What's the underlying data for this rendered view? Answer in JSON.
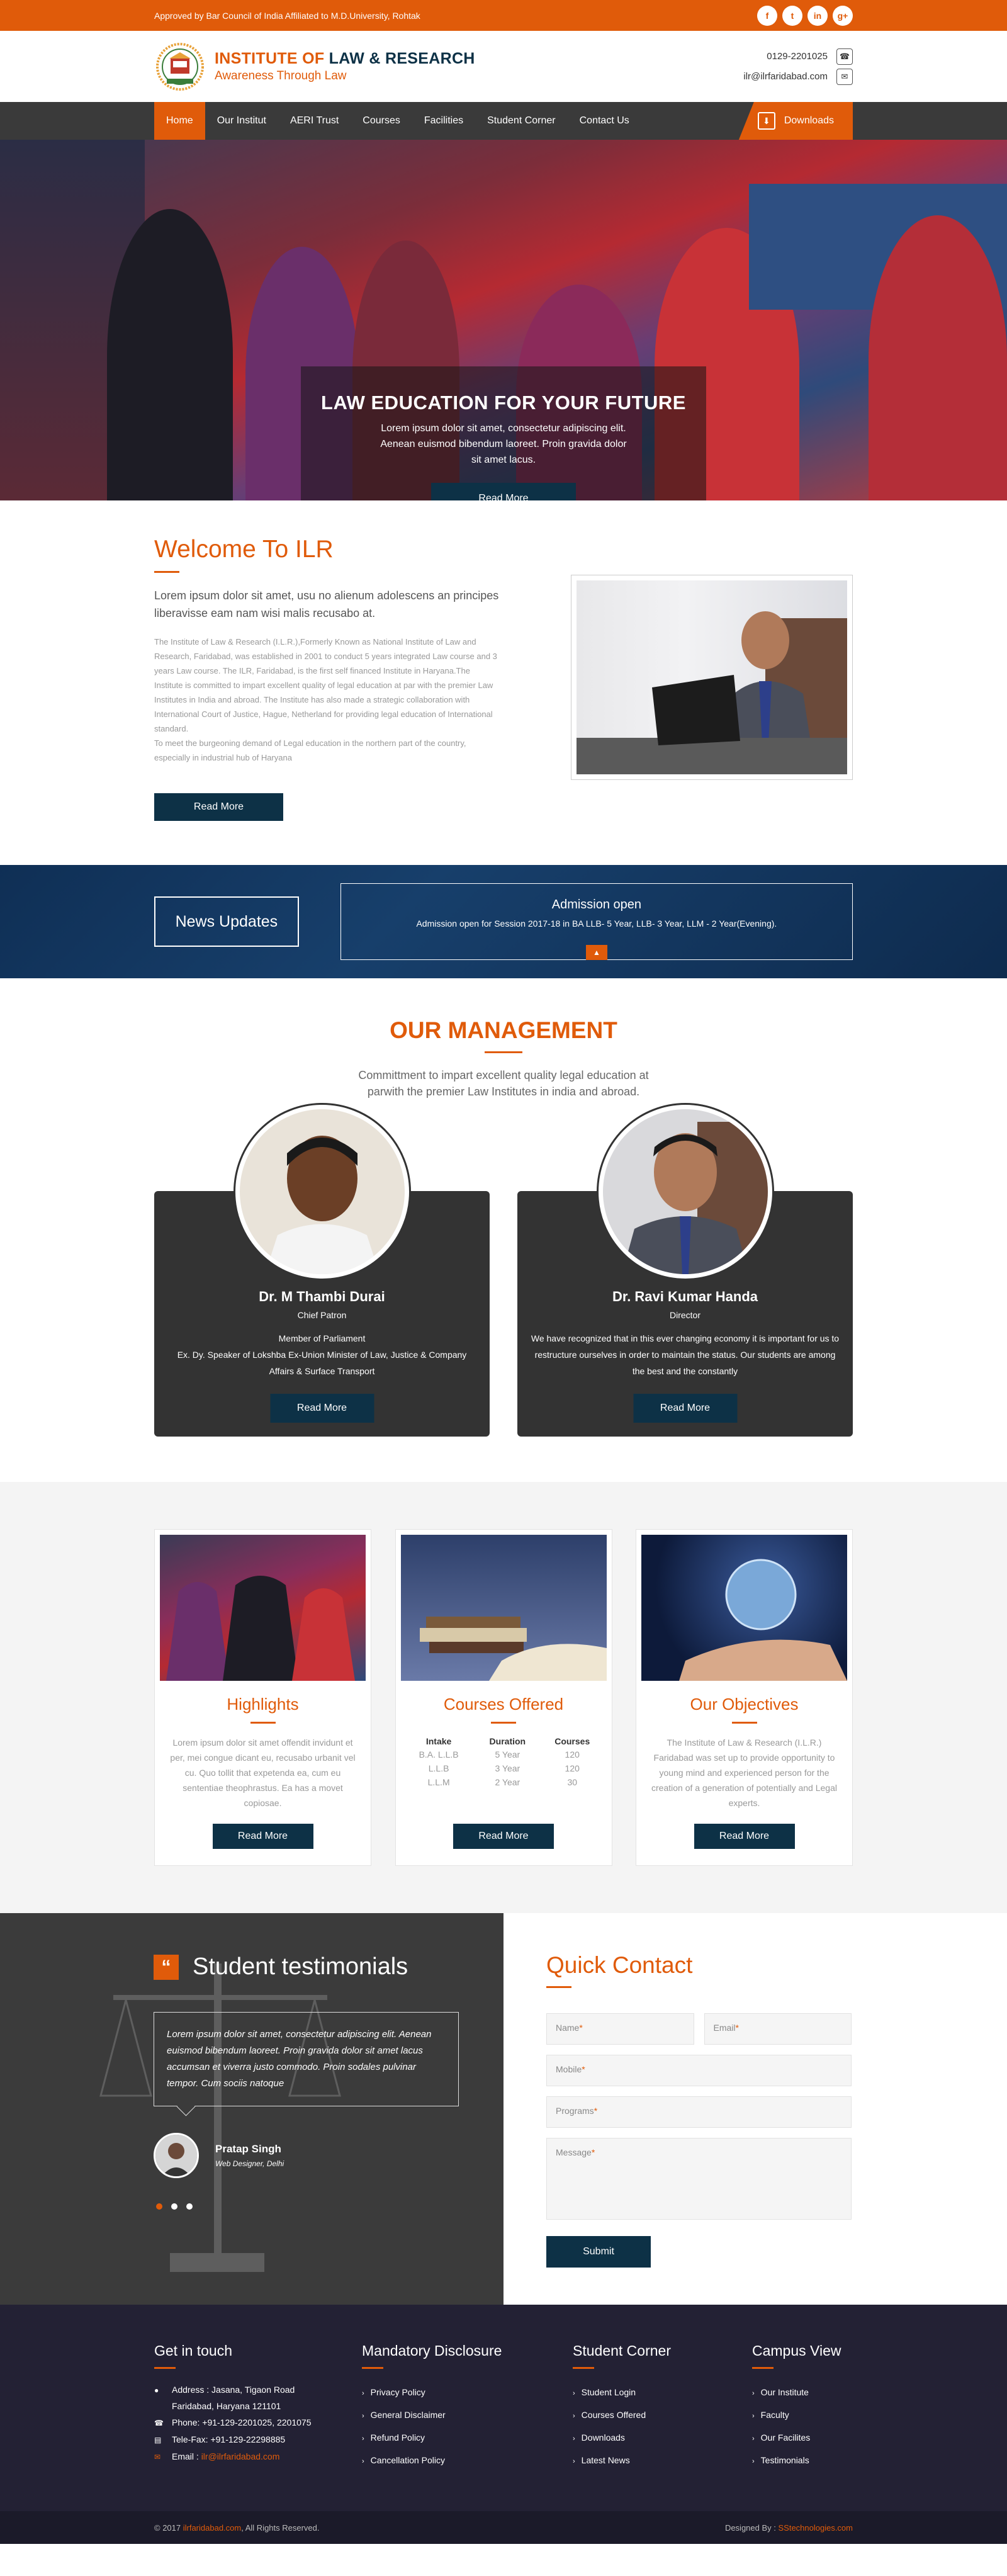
{
  "topbar": {
    "approved": "Approved by Bar Council of India Affiliated to M.D.University, Rohtak",
    "social": [
      "f",
      "t",
      "in",
      "g+"
    ]
  },
  "brand": {
    "title_part1": "INSTITUTE OF ",
    "title_part2": "LAW & RESEARCH",
    "tagline": "Awareness Through Law",
    "phone": "0129-2201025",
    "email": "ilr@ilrfaridabad.com"
  },
  "nav": {
    "items": [
      "Home",
      "Our Institut",
      "AERI Trust",
      "Courses",
      "Facilities",
      "Student Corner",
      "Contact Us"
    ],
    "downloads": "Downloads"
  },
  "hero": {
    "title": "LAW EDUCATION FOR YOUR FUTURE",
    "text": "Lorem ipsum dolor sit amet, consectetur adipiscing elit. Aenean euismod bibendum laoreet. Proin gravida dolor sit amet lacus.",
    "button": "Read More"
  },
  "welcome": {
    "title": "Welcome To ILR",
    "lead": "Lorem ipsum dolor sit amet, usu no alienum adolescens an principes liberavisse eam nam wisi malis recusabo at.",
    "body": "The Institute of Law & Research (I.L.R.),Formerly Known as National Institute of Law and Research, Faridabad, was established in 2001 to conduct 5 years integrated Law course and 3 years Law course. The ILR, Faridabad, is the first self financed Institute in Haryana.The Institute is committed to impart excellent quality of legal education at par with the premier Law Institutes in India and abroad. The Institute has also made a strategic collaboration with International Court of Justice, Hague, Netherland for providing legal education of International standard.",
    "body2": "To meet the burgeoning demand of Legal education in the northern part of the country, especially in industrial hub of Haryana",
    "button": "Read More"
  },
  "news": {
    "label": "News Updates",
    "title": "Admission open",
    "text": "Admission open for  Session 2017-18 in BA LLB- 5 Year, LLB- 3 Year, LLM - 2 Year(Evening)."
  },
  "management": {
    "title": "OUR MANAGEMENT",
    "subtitle": "Committment to impart excellent quality legal education at parwith the premier Law Institutes in india and abroad.",
    "people": [
      {
        "name": "Dr. M Thambi Durai",
        "role": "Chief Patron",
        "desc": "Member of Parliament\nEx. Dy. Speaker of Lokshba Ex-Union Minister of Law, Justice & Company Affairs & Surface Transport",
        "button": "Read More"
      },
      {
        "name": "Dr. Ravi Kumar Handa",
        "role": "Director",
        "desc": "We have recognized that in this ever changing economy it is important for us to restructure ourselves in order to maintain the status.  Our students are among the best and the constantly",
        "button": "Read More"
      }
    ]
  },
  "features": [
    {
      "title": "Highlights",
      "text": "Lorem ipsum dolor sit amet offendit invidunt et per, mei congue dicant eu, recusabo urbanit vel cu. Quo tollit that expetenda ea, cum eu sententiae theophrastus. Ea has a movet copiosae.",
      "button": "Read More"
    },
    {
      "title": "Courses Offered",
      "table": {
        "headers": [
          "Intake",
          "Duration",
          "Courses"
        ],
        "rows": [
          [
            "B.A. L.L.B",
            "5 Year",
            "120"
          ],
          [
            "L.L.B",
            "3 Year",
            "120"
          ],
          [
            "L.L.M",
            "2 Year",
            "30"
          ]
        ]
      },
      "button": "Read More"
    },
    {
      "title": "Our Objectives",
      "text": "The Institute of Law & Research (I.L.R.) Faridabad was set up to provide opportunity to young mind and experienced person for the creation of a generation of potentially and Legal experts.",
      "button": "Read More"
    }
  ],
  "testimonials": {
    "title": "Student testimonials",
    "quote": "Lorem ipsum dolor sit amet, consectetur adipiscing elit. Aenean euismod bibendum laoreet. Proin gravida dolor sit amet lacus accumsan et viverra justo commodo. Proin sodales pulvinar tempor. Cum sociis natoque",
    "name": "Pratap Singh",
    "role": "Web Designer, Delhi"
  },
  "contact": {
    "title": "Quick Contact",
    "name_ph": "Name",
    "email_ph": "Email",
    "mobile_ph": "Mobile",
    "programs_ph": "Programs",
    "message_ph": "Message",
    "required_mark": "*",
    "submit": "Submit"
  },
  "footer": {
    "getintouch": {
      "title": "Get in touch",
      "address": "Address : Jasana, Tigaon Road Faridabad, Haryana 121101",
      "phone": "Phone: +91-129-2201025, 2201075",
      "telefax": "Tele-Fax: +91-129-22298885",
      "email_label": "Email : ",
      "email": "ilr@ilrfaridabad.com"
    },
    "mandatory": {
      "title": "Mandatory Disclosure",
      "items": [
        "Privacy Policy",
        "General Disclaimer",
        "Refund Policy",
        "Cancellation Policy"
      ]
    },
    "student": {
      "title": "Student Corner",
      "items": [
        "Student Login",
        "Courses Offered",
        "Downloads",
        "Latest News"
      ]
    },
    "campus": {
      "title": "Campus View",
      "items": [
        "Our Institute",
        "Faculty",
        "Our Facilites",
        "Testimonials"
      ]
    },
    "copyright_pre": "© 2017 ",
    "copyright_site": "ilrfaridabad.com",
    "copyright_post": ", All Rights Reserved.",
    "designed_pre": "Designed By : ",
    "designed_by": "SStechnologies.com"
  },
  "colors": {
    "accent": "#e05b0a",
    "navy": "#0d3146",
    "nav_bg": "#3a3a3a",
    "footer_bg": "#232134"
  }
}
